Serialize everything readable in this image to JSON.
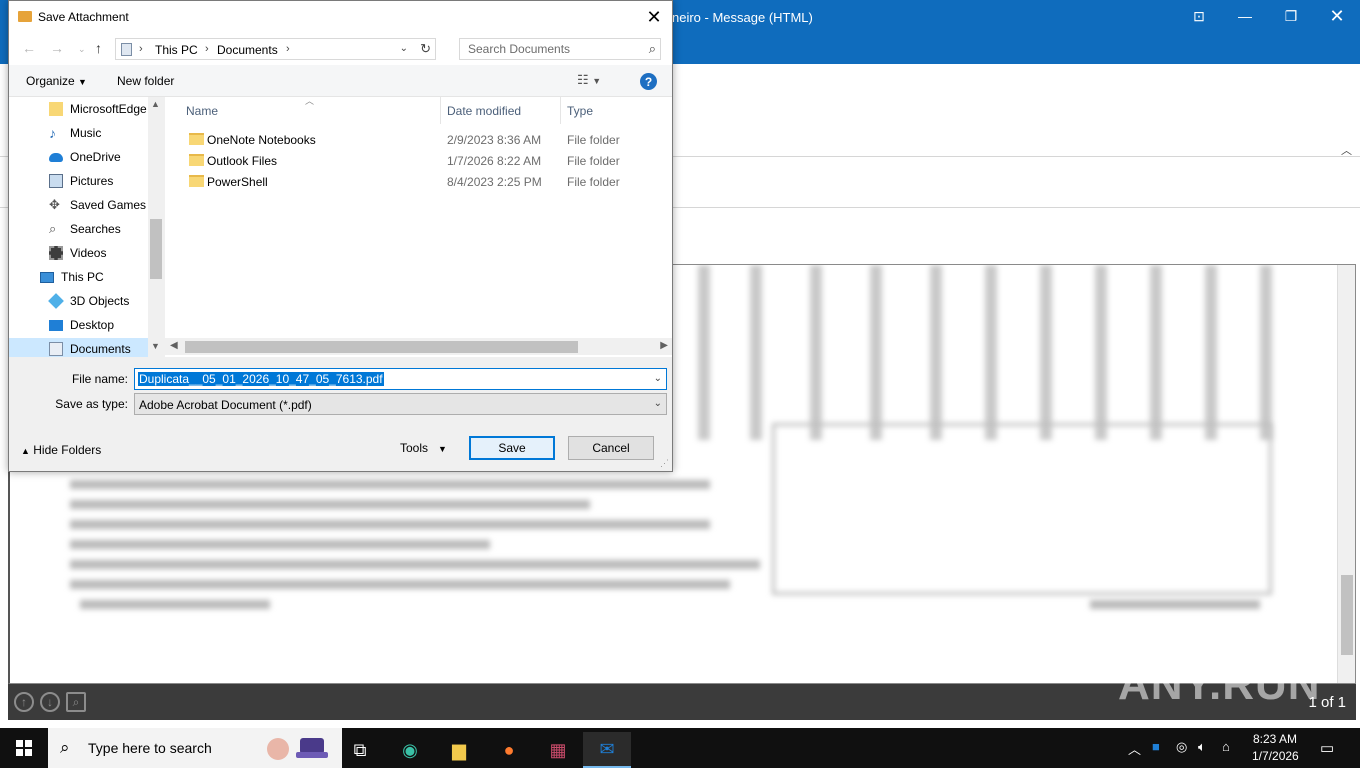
{
  "outlook": {
    "title": "neiro  -  Message (HTML)",
    "page_count": "1 of 1",
    "watermark": "ANY.RUN"
  },
  "dialog": {
    "title": "Save Attachment",
    "breadcrumb": [
      "This PC",
      "Documents"
    ],
    "search_placeholder": "Search Documents",
    "toolbar": {
      "organize": "Organize",
      "new_folder": "New folder"
    },
    "nav_items": [
      {
        "label": "MicrosoftEdge",
        "icon": "folder-icon"
      },
      {
        "label": "Music",
        "icon": "music-icon"
      },
      {
        "label": "OneDrive",
        "icon": "cloud-icon"
      },
      {
        "label": "Pictures",
        "icon": "pictures-icon"
      },
      {
        "label": "Saved Games",
        "icon": "games-icon"
      },
      {
        "label": "Searches",
        "icon": "search-icon"
      },
      {
        "label": "Videos",
        "icon": "video-icon"
      },
      {
        "label": "This PC",
        "icon": "computer-icon"
      },
      {
        "label": "3D Objects",
        "icon": "cube-icon"
      },
      {
        "label": "Desktop",
        "icon": "desktop-icon"
      },
      {
        "label": "Documents",
        "icon": "documents-icon",
        "selected": true
      }
    ],
    "columns": {
      "name": "Name",
      "date": "Date modified",
      "type": "Type"
    },
    "files": [
      {
        "name": "OneNote Notebooks",
        "date": "2/9/2023 8:36 AM",
        "type": "File folder"
      },
      {
        "name": "Outlook Files",
        "date": "1/7/2026 8:22 AM",
        "type": "File folder"
      },
      {
        "name": "PowerShell",
        "date": "8/4/2023 2:25 PM",
        "type": "File folder"
      }
    ],
    "file_name_label": "File name:",
    "file_name_value": "Duplicata__05_01_2026_10_47_05_7613.pdf",
    "save_type_label": "Save as type:",
    "save_type_value": "Adobe Acrobat Document (*.pdf)",
    "hide_folders": "Hide Folders",
    "tools": "Tools",
    "save": "Save",
    "cancel": "Cancel"
  },
  "taskbar": {
    "search_text": "Type here to search",
    "time": "8:23 AM",
    "date": "1/7/2026",
    "accent": "#76b9ed"
  }
}
